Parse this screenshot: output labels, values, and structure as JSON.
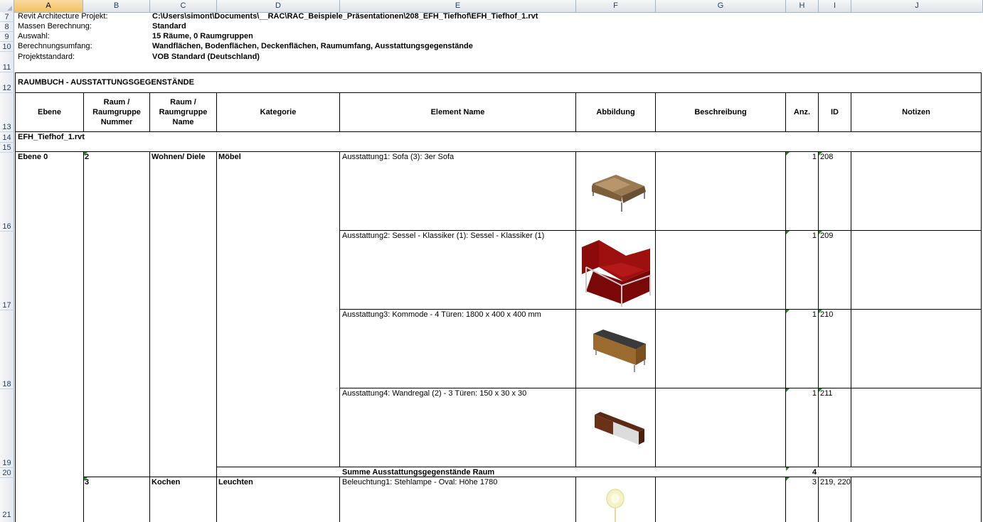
{
  "columns": [
    "A",
    "B",
    "C",
    "D",
    "E",
    "F",
    "G",
    "H",
    "I",
    "J"
  ],
  "rows": [
    "7",
    "8",
    "9",
    "10",
    "11",
    "12",
    "13",
    "14",
    "15",
    "16",
    "17",
    "18",
    "19",
    "20",
    "21"
  ],
  "info": {
    "project_label": "Revit Architecture Projekt:",
    "project_value": "C:\\Users\\simont\\Documents\\__RAC\\RAC_Beispiele_Präsentationen\\208_EFH_Tiefhof\\EFH_Tiefhof_1.rvt",
    "calc_label": "Massen Berechnung:",
    "calc_value": "Standard",
    "selection_label": "Auswahl:",
    "selection_value": "15 Räume, 0 Raumgruppen",
    "scope_label": "Berechnungsumfang:",
    "scope_value": "Wandflächen, Bodenflächen, Deckenflächen, Raumumfang, Ausstattungsgegenstände",
    "standard_label": "Projektstandard:",
    "standard_value": "VOB Standard (Deutschland)"
  },
  "table": {
    "title": "RAUMBUCH - AUSSTATTUNGSGEGENSTÄNDE",
    "headers": {
      "ebene": "Ebene",
      "nummer_1": "Raum /",
      "nummer_2": "Raumgruppe",
      "nummer_3": "Nummer",
      "name_1": "Raum /",
      "name_2": "Raumgruppe",
      "name_3": "Name",
      "kategorie": "Kategorie",
      "element": "Element Name",
      "abbildung": "Abbildung",
      "beschreibung": "Beschreibung",
      "anz": "Anz.",
      "id": "ID",
      "notizen": "Notizen"
    },
    "file": "EFH_Tiefhof_1.rvt",
    "level": "Ebene 0",
    "room1": {
      "number": "2",
      "name": "Wohnen/ Diele",
      "category": "Möbel"
    },
    "items": [
      {
        "element": "Ausstattung1: Sofa (3): 3er Sofa",
        "anz": "1",
        "id": "208",
        "icon": "sofa-image"
      },
      {
        "element": "Ausstattung2: Sessel - Klassiker (1): Sessel - Klassiker (1)",
        "anz": "1",
        "id": "209",
        "icon": "armchair-image"
      },
      {
        "element": "Ausstattung3: Kommode - 4 Türen: 1800 x 400 x 400 mm",
        "anz": "1",
        "id": "210",
        "icon": "sideboard-image"
      },
      {
        "element": "Ausstattung4: Wandregal (2) - 3 Türen: 150 x 30 x 30",
        "anz": "1",
        "id": "211",
        "icon": "wall-shelf-image"
      }
    ],
    "sum_label": "Summe Ausstattungsgegenstände Raum",
    "sum_value": "4",
    "room2": {
      "number": "3",
      "name": "Kochen",
      "category": "Leuchten",
      "element": "Beleuchtung1: Stehlampe - Oval: Höhe 1780",
      "anz": "3",
      "id": "219, 220",
      "icon": "floor-lamp-image"
    }
  },
  "colors": {
    "selected_header": "#f1c15f",
    "header_bg": "#dfe3e8",
    "note_marker": "#1a8a1a"
  }
}
